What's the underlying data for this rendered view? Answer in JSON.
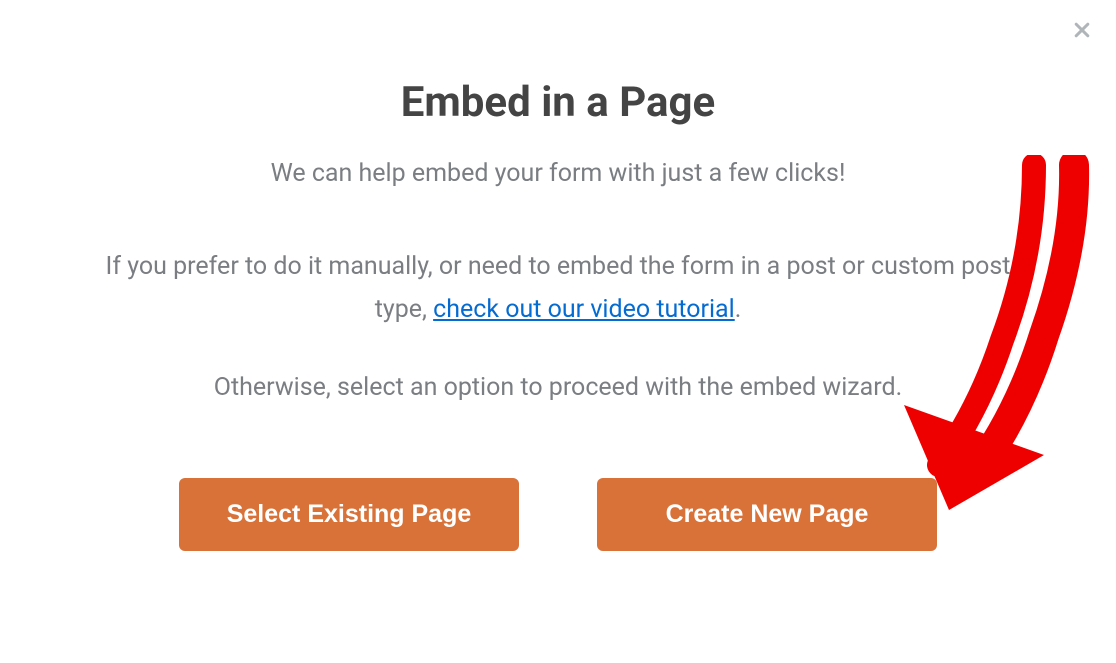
{
  "modal": {
    "title": "Embed in a Page",
    "subtitle": "We can help embed your form with just a few clicks!",
    "body_prefix": "If you prefer to do it manually, or need to embed the form in a post or custom post type, ",
    "link_text": "check out our video tutorial",
    "body_suffix": ".",
    "body2": "Otherwise, select an option to proceed with the embed wizard.",
    "buttons": {
      "select_existing": "Select Existing Page",
      "create_new": "Create New Page"
    }
  }
}
